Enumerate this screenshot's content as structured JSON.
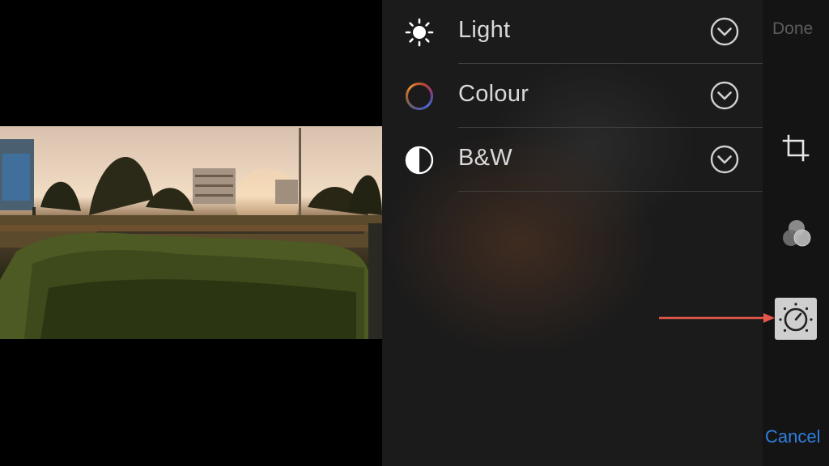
{
  "adjustments": [
    {
      "label": "Light",
      "icon": "sun-icon"
    },
    {
      "label": "Colour",
      "icon": "color-wheel-icon"
    },
    {
      "label": "B&W",
      "icon": "half-circle-icon"
    }
  ],
  "toolbar": {
    "done_label": "Done",
    "cancel_label": "Cancel",
    "tools": [
      "crop-icon",
      "filters-icon",
      "adjust-dial-icon"
    ],
    "selected_tool": "adjust-dial-icon"
  },
  "colors": {
    "panel_background": "#1b1b1b",
    "toolbar_background": "#141414",
    "cancel_blue": "#2d7fe0",
    "done_disabled": "#5c5c5c",
    "annotation_arrow": "#e8584a"
  }
}
